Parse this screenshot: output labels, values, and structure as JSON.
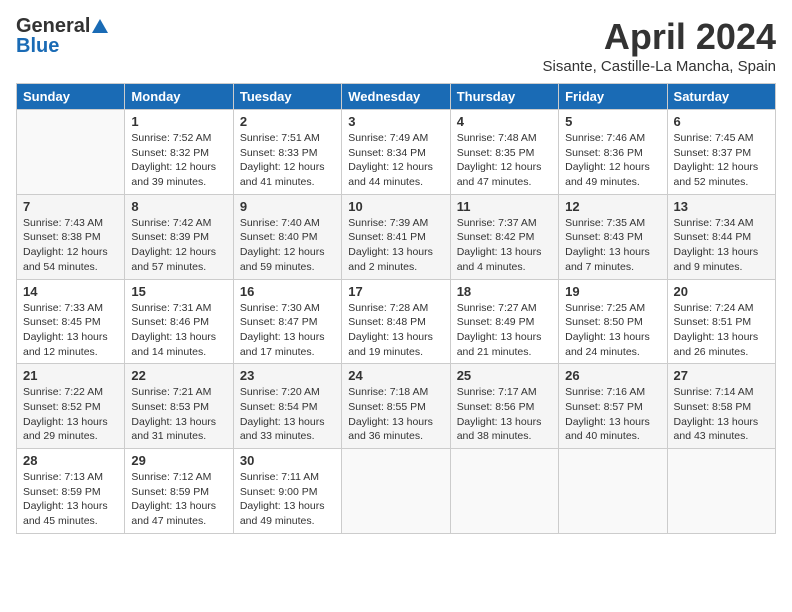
{
  "logo": {
    "general": "General",
    "blue": "Blue"
  },
  "title": "April 2024",
  "subtitle": "Sisante, Castille-La Mancha, Spain",
  "days_of_week": [
    "Sunday",
    "Monday",
    "Tuesday",
    "Wednesday",
    "Thursday",
    "Friday",
    "Saturday"
  ],
  "weeks": [
    [
      {
        "day": "",
        "info": ""
      },
      {
        "day": "1",
        "info": "Sunrise: 7:52 AM\nSunset: 8:32 PM\nDaylight: 12 hours\nand 39 minutes."
      },
      {
        "day": "2",
        "info": "Sunrise: 7:51 AM\nSunset: 8:33 PM\nDaylight: 12 hours\nand 41 minutes."
      },
      {
        "day": "3",
        "info": "Sunrise: 7:49 AM\nSunset: 8:34 PM\nDaylight: 12 hours\nand 44 minutes."
      },
      {
        "day": "4",
        "info": "Sunrise: 7:48 AM\nSunset: 8:35 PM\nDaylight: 12 hours\nand 47 minutes."
      },
      {
        "day": "5",
        "info": "Sunrise: 7:46 AM\nSunset: 8:36 PM\nDaylight: 12 hours\nand 49 minutes."
      },
      {
        "day": "6",
        "info": "Sunrise: 7:45 AM\nSunset: 8:37 PM\nDaylight: 12 hours\nand 52 minutes."
      }
    ],
    [
      {
        "day": "7",
        "info": "Sunrise: 7:43 AM\nSunset: 8:38 PM\nDaylight: 12 hours\nand 54 minutes."
      },
      {
        "day": "8",
        "info": "Sunrise: 7:42 AM\nSunset: 8:39 PM\nDaylight: 12 hours\nand 57 minutes."
      },
      {
        "day": "9",
        "info": "Sunrise: 7:40 AM\nSunset: 8:40 PM\nDaylight: 12 hours\nand 59 minutes."
      },
      {
        "day": "10",
        "info": "Sunrise: 7:39 AM\nSunset: 8:41 PM\nDaylight: 13 hours\nand 2 minutes."
      },
      {
        "day": "11",
        "info": "Sunrise: 7:37 AM\nSunset: 8:42 PM\nDaylight: 13 hours\nand 4 minutes."
      },
      {
        "day": "12",
        "info": "Sunrise: 7:35 AM\nSunset: 8:43 PM\nDaylight: 13 hours\nand 7 minutes."
      },
      {
        "day": "13",
        "info": "Sunrise: 7:34 AM\nSunset: 8:44 PM\nDaylight: 13 hours\nand 9 minutes."
      }
    ],
    [
      {
        "day": "14",
        "info": "Sunrise: 7:33 AM\nSunset: 8:45 PM\nDaylight: 13 hours\nand 12 minutes."
      },
      {
        "day": "15",
        "info": "Sunrise: 7:31 AM\nSunset: 8:46 PM\nDaylight: 13 hours\nand 14 minutes."
      },
      {
        "day": "16",
        "info": "Sunrise: 7:30 AM\nSunset: 8:47 PM\nDaylight: 13 hours\nand 17 minutes."
      },
      {
        "day": "17",
        "info": "Sunrise: 7:28 AM\nSunset: 8:48 PM\nDaylight: 13 hours\nand 19 minutes."
      },
      {
        "day": "18",
        "info": "Sunrise: 7:27 AM\nSunset: 8:49 PM\nDaylight: 13 hours\nand 21 minutes."
      },
      {
        "day": "19",
        "info": "Sunrise: 7:25 AM\nSunset: 8:50 PM\nDaylight: 13 hours\nand 24 minutes."
      },
      {
        "day": "20",
        "info": "Sunrise: 7:24 AM\nSunset: 8:51 PM\nDaylight: 13 hours\nand 26 minutes."
      }
    ],
    [
      {
        "day": "21",
        "info": "Sunrise: 7:22 AM\nSunset: 8:52 PM\nDaylight: 13 hours\nand 29 minutes."
      },
      {
        "day": "22",
        "info": "Sunrise: 7:21 AM\nSunset: 8:53 PM\nDaylight: 13 hours\nand 31 minutes."
      },
      {
        "day": "23",
        "info": "Sunrise: 7:20 AM\nSunset: 8:54 PM\nDaylight: 13 hours\nand 33 minutes."
      },
      {
        "day": "24",
        "info": "Sunrise: 7:18 AM\nSunset: 8:55 PM\nDaylight: 13 hours\nand 36 minutes."
      },
      {
        "day": "25",
        "info": "Sunrise: 7:17 AM\nSunset: 8:56 PM\nDaylight: 13 hours\nand 38 minutes."
      },
      {
        "day": "26",
        "info": "Sunrise: 7:16 AM\nSunset: 8:57 PM\nDaylight: 13 hours\nand 40 minutes."
      },
      {
        "day": "27",
        "info": "Sunrise: 7:14 AM\nSunset: 8:58 PM\nDaylight: 13 hours\nand 43 minutes."
      }
    ],
    [
      {
        "day": "28",
        "info": "Sunrise: 7:13 AM\nSunset: 8:59 PM\nDaylight: 13 hours\nand 45 minutes."
      },
      {
        "day": "29",
        "info": "Sunrise: 7:12 AM\nSunset: 8:59 PM\nDaylight: 13 hours\nand 47 minutes."
      },
      {
        "day": "30",
        "info": "Sunrise: 7:11 AM\nSunset: 9:00 PM\nDaylight: 13 hours\nand 49 minutes."
      },
      {
        "day": "",
        "info": ""
      },
      {
        "day": "",
        "info": ""
      },
      {
        "day": "",
        "info": ""
      },
      {
        "day": "",
        "info": ""
      }
    ]
  ]
}
